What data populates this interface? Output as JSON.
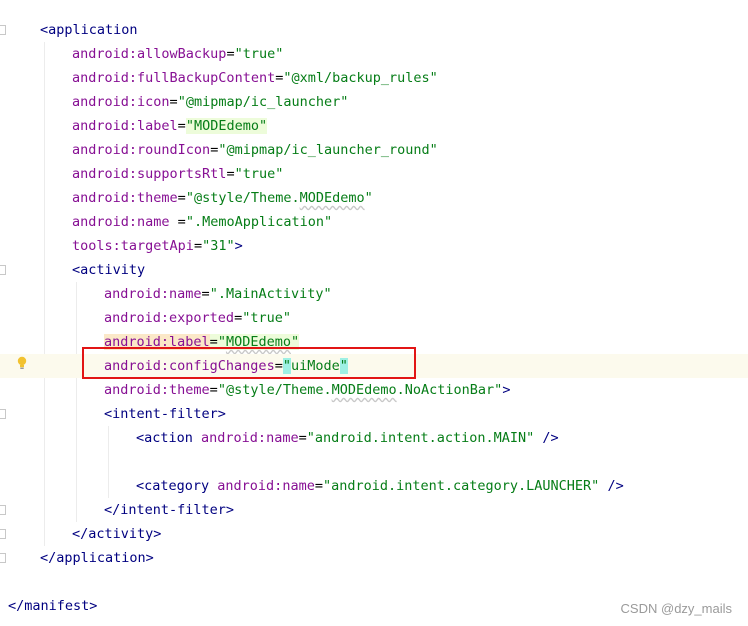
{
  "lines": [
    [
      {
        "c": "tag",
        "t": "<application"
      }
    ],
    [
      {
        "c": "attr-ns",
        "t": "android:"
      },
      {
        "c": "attr-name",
        "t": "allowBackup"
      },
      {
        "c": "eq",
        "t": "="
      },
      {
        "c": "val",
        "t": "\"true\""
      }
    ],
    [
      {
        "c": "attr-ns",
        "t": "android:"
      },
      {
        "c": "attr-name",
        "t": "fullBackupContent"
      },
      {
        "c": "eq",
        "t": "="
      },
      {
        "c": "val",
        "t": "\"@xml/backup_rules\""
      }
    ],
    [
      {
        "c": "attr-ns",
        "t": "android:"
      },
      {
        "c": "attr-name",
        "t": "icon"
      },
      {
        "c": "eq",
        "t": "="
      },
      {
        "c": "val",
        "t": "\"@mipmap/ic_launcher\""
      }
    ],
    [
      {
        "c": "attr-ns",
        "t": "android:"
      },
      {
        "c": "attr-name",
        "t": "label"
      },
      {
        "c": "eq",
        "t": "="
      },
      {
        "c": "val hl-green",
        "t": "\"MODEdemo\""
      }
    ],
    [
      {
        "c": "attr-ns",
        "t": "android:"
      },
      {
        "c": "attr-name",
        "t": "roundIcon"
      },
      {
        "c": "eq",
        "t": "="
      },
      {
        "c": "val",
        "t": "\"@mipmap/ic_launcher_round\""
      }
    ],
    [
      {
        "c": "attr-ns",
        "t": "android:"
      },
      {
        "c": "attr-name",
        "t": "supportsRtl"
      },
      {
        "c": "eq",
        "t": "="
      },
      {
        "c": "val",
        "t": "\"true\""
      }
    ],
    [
      {
        "c": "attr-ns",
        "t": "android:"
      },
      {
        "c": "attr-name",
        "t": "theme"
      },
      {
        "c": "eq",
        "t": "="
      },
      {
        "c": "val",
        "t": "\"@style/Theme."
      },
      {
        "c": "val squiggle",
        "t": "MODEdemo"
      },
      {
        "c": "val",
        "t": "\""
      }
    ],
    [
      {
        "c": "attr-ns",
        "t": "android:"
      },
      {
        "c": "attr-name",
        "t": "name "
      },
      {
        "c": "eq",
        "t": "="
      },
      {
        "c": "val",
        "t": "\".MemoApplication\""
      }
    ],
    [
      {
        "c": "tools-ns",
        "t": "tools:"
      },
      {
        "c": "attr-name",
        "t": "targetApi"
      },
      {
        "c": "eq",
        "t": "="
      },
      {
        "c": "val",
        "t": "\"31\""
      },
      {
        "c": "tag",
        "t": ">"
      }
    ],
    [
      {
        "c": "tag",
        "t": "<activity"
      }
    ],
    [
      {
        "c": "attr-ns",
        "t": "android:"
      },
      {
        "c": "attr-name",
        "t": "name"
      },
      {
        "c": "eq",
        "t": "="
      },
      {
        "c": "val",
        "t": "\".MainActivity\""
      }
    ],
    [
      {
        "c": "attr-ns",
        "t": "android:"
      },
      {
        "c": "attr-name",
        "t": "exported"
      },
      {
        "c": "eq",
        "t": "="
      },
      {
        "c": "val",
        "t": "\"true\""
      }
    ],
    [
      {
        "c": "attr-ns hl-orange",
        "t": "android:"
      },
      {
        "c": "attr-name hl-orange",
        "t": "label"
      },
      {
        "c": "eq hl-green",
        "t": "="
      },
      {
        "c": "val hl-green",
        "t": "\""
      },
      {
        "c": "val hl-green squiggle",
        "t": "MODEdemo"
      },
      {
        "c": "val hl-green",
        "t": "\""
      }
    ],
    [
      {
        "c": "attr-ns",
        "t": "android:"
      },
      {
        "c": "attr-name",
        "t": "configChanges"
      },
      {
        "c": "eq",
        "t": "="
      },
      {
        "c": "val quote-match",
        "t": "\""
      },
      {
        "c": "val",
        "t": "uiMode"
      },
      {
        "c": "val quote-match",
        "t": "\""
      }
    ],
    [
      {
        "c": "attr-ns",
        "t": "android:"
      },
      {
        "c": "attr-name",
        "t": "theme"
      },
      {
        "c": "eq",
        "t": "="
      },
      {
        "c": "val",
        "t": "\"@style/Theme."
      },
      {
        "c": "val squiggle",
        "t": "MODEdemo"
      },
      {
        "c": "val",
        "t": ".NoActionBar\""
      },
      {
        "c": "tag",
        "t": ">"
      }
    ],
    [
      {
        "c": "tag",
        "t": "<intent-filter>"
      }
    ],
    [
      {
        "c": "tag",
        "t": "<action "
      },
      {
        "c": "attr-ns",
        "t": "android:"
      },
      {
        "c": "attr-name",
        "t": "name"
      },
      {
        "c": "eq",
        "t": "="
      },
      {
        "c": "val",
        "t": "\"android.intent.action.MAIN\""
      },
      {
        "c": "tag",
        "t": " />"
      }
    ],
    [],
    [
      {
        "c": "tag",
        "t": "<category "
      },
      {
        "c": "attr-ns",
        "t": "android:"
      },
      {
        "c": "attr-name",
        "t": "name"
      },
      {
        "c": "eq",
        "t": "="
      },
      {
        "c": "val",
        "t": "\"android.intent.category.LAUNCHER\""
      },
      {
        "c": "tag",
        "t": " />"
      }
    ],
    [
      {
        "c": "tag",
        "t": "</intent-filter>"
      }
    ],
    [
      {
        "c": "tag",
        "t": "</activity>"
      }
    ],
    [
      {
        "c": "tag",
        "t": "</application>"
      }
    ],
    [],
    [
      {
        "c": "tag",
        "t": "</manifest>"
      }
    ]
  ],
  "watermark": "CSDN @dzy_mails",
  "icons": {
    "intention": "lightbulb-icon",
    "fold": "fold-marker-icon"
  },
  "colors": {
    "tag": "#000080",
    "attribute": "#871094",
    "value": "#067d17",
    "highlight_box": "#e21515",
    "current_line": "#fcfaed"
  }
}
